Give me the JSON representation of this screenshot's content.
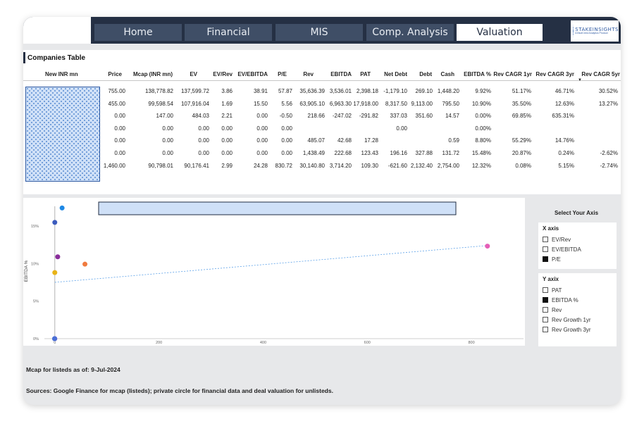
{
  "nav": {
    "tabs": [
      {
        "label": "Home"
      },
      {
        "label": "Financial"
      },
      {
        "label": "MIS"
      },
      {
        "label": "Comp. Analysis"
      },
      {
        "label": "Valuation"
      }
    ],
    "active_tab": "Valuation",
    "logo": {
      "line1": "STAKEINSIGHTS",
      "line2": "A BlueCrest Analytics Product"
    }
  },
  "table": {
    "title": "Companies Table",
    "columns": [
      "New INR mn",
      "Price",
      "Mcap (INR mn)",
      "EV",
      "EV/Rev",
      "EV/EBITDA",
      "P/E",
      "Rev",
      "EBITDA",
      "PAT",
      "Net Debt",
      "Debt",
      "Cash",
      "EBITDA %",
      "Rev CAGR 1yr",
      "Rev CAGR 3yr",
      "Rev CAGR 5yr"
    ],
    "sort_column": "Rev CAGR 5yr",
    "rows": [
      [
        "755.00",
        "138,778.82",
        "137,599.72",
        "3.86",
        "38.91",
        "57.87",
        "35,636.39",
        "3,536.01",
        "2,398.18",
        "-1,179.10",
        "269.10",
        "1,448.20",
        "9.92%",
        "51.17%",
        "46.71%",
        "30.52%"
      ],
      [
        "455.00",
        "99,598.54",
        "107,916.04",
        "1.69",
        "15.50",
        "5.56",
        "63,905.10",
        "6,963.30",
        "17,918.00",
        "8,317.50",
        "9,113.00",
        "795.50",
        "10.90%",
        "35.50%",
        "12.63%",
        "13.27%"
      ],
      [
        "0.00",
        "147.00",
        "484.03",
        "2.21",
        "0.00",
        "-0.50",
        "218.66",
        "-247.02",
        "-291.82",
        "337.03",
        "351.60",
        "14.57",
        "0.00%",
        "69.85%",
        "635.31%",
        ""
      ],
      [
        "0.00",
        "0.00",
        "0.00",
        "0.00",
        "0.00",
        "0.00",
        "",
        "",
        "",
        "0.00",
        "",
        "",
        "0.00%",
        "",
        "",
        ""
      ],
      [
        "0.00",
        "0.00",
        "0.00",
        "0.00",
        "0.00",
        "0.00",
        "485.07",
        "42.68",
        "17.28",
        "",
        "",
        "0.59",
        "8.80%",
        "55.29%",
        "14.76%",
        ""
      ],
      [
        "0.00",
        "0.00",
        "0.00",
        "0.00",
        "0.00",
        "0.00",
        "1,438.49",
        "222.68",
        "123.43",
        "196.16",
        "327.88",
        "131.72",
        "15.48%",
        "20.87%",
        "0.24%",
        "-2.62%"
      ],
      [
        "1,460.00",
        "90,798.01",
        "90,176.41",
        "2.99",
        "24.28",
        "830.72",
        "30,140.80",
        "3,714.20",
        "109.30",
        "-621.60",
        "2,132.40",
        "2,754.00",
        "12.32%",
        "0.08%",
        "5.15%",
        "-2.74%"
      ]
    ]
  },
  "chart_data": {
    "type": "scatter",
    "xlabel": "P/E",
    "ylabel": "EBITDA %",
    "xlim": [
      -20,
      900
    ],
    "ylim": [
      0,
      18
    ],
    "x_ticks": [
      0,
      200,
      400,
      600,
      800
    ],
    "x_tick_labels": [
      "0",
      "200",
      "400",
      "600",
      "800"
    ],
    "y_ticks": [
      0,
      5,
      10,
      15
    ],
    "y_tick_labels": [
      "0%",
      "5%",
      "10%",
      "15%"
    ],
    "points": [
      {
        "x": 0,
        "y": 15.48,
        "color": "#3b5bbd"
      },
      {
        "x": 5.56,
        "y": 10.9,
        "color": "#8a2e9b"
      },
      {
        "x": 0,
        "y": 8.8,
        "color": "#e8b317"
      },
      {
        "x": 57.87,
        "y": 9.92,
        "color": "#f07b3f"
      },
      {
        "x": 830.72,
        "y": 12.32,
        "color": "#e55fb7"
      },
      {
        "x": 0,
        "y": 0,
        "color": "#6a5acd"
      },
      {
        "x": -0.5,
        "y": 0,
        "color": "#4a6fd6"
      },
      {
        "x": 14,
        "y": 17.4,
        "color": "#1e88e5"
      }
    ],
    "trend_line": {
      "x": [
        0,
        830.72
      ],
      "y": [
        7.5,
        12.4
      ],
      "color": "#5aa0e8"
    },
    "grid": false
  },
  "axis_selector": {
    "title": "Select Your Axis",
    "x_axis": {
      "label": "X axis",
      "options": [
        {
          "label": "EV/Rev",
          "checked": false
        },
        {
          "label": "EV/EBITDA",
          "checked": false
        },
        {
          "label": "P/E",
          "checked": true
        }
      ]
    },
    "y_axis": {
      "label": "Y axix",
      "options": [
        {
          "label": "PAT",
          "checked": false
        },
        {
          "label": "EBITDA %",
          "checked": true
        },
        {
          "label": "Rev",
          "checked": false
        },
        {
          "label": "Rev Growth 1yr",
          "checked": false
        },
        {
          "label": "Rev Growth 3yr",
          "checked": false
        }
      ]
    }
  },
  "footer": {
    "mcap_note": "Mcap for listeds as of: 9-Jul-2024",
    "sources": "Sources: Google Finance for mcap (listeds); private circle for financial data and deal valuation for unlisteds."
  }
}
